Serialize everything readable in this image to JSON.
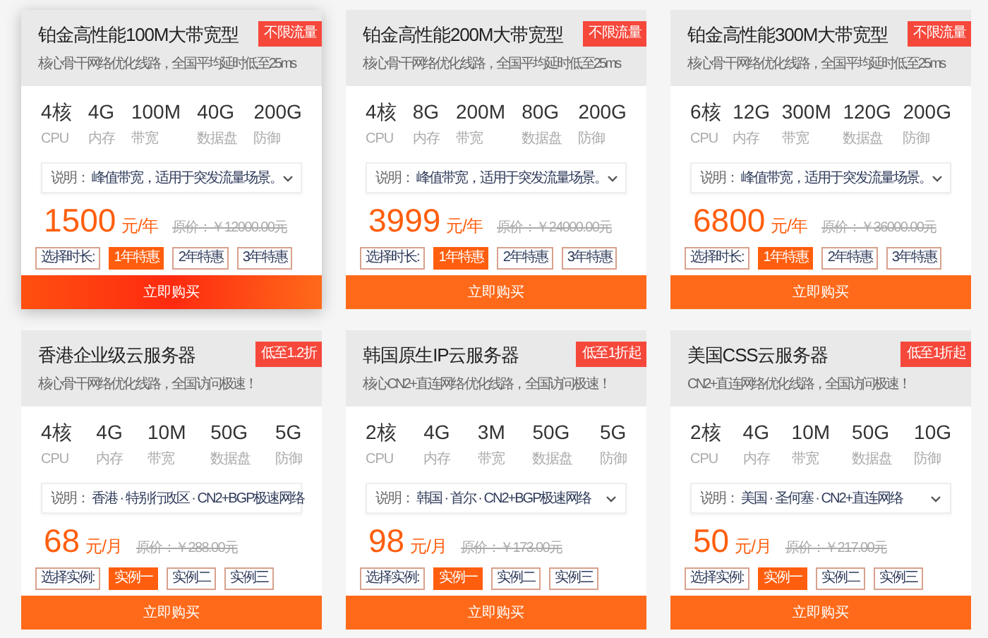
{
  "cards": [
    {
      "title": "铂金高性能100M大带宽型",
      "badge": "不限流量",
      "subtitle": "核心骨干网络优化线路，全国平均延时低至25ms",
      "hovered": true,
      "specs": [
        {
          "value": "4核",
          "label": "CPU"
        },
        {
          "value": "4G",
          "label": "内存"
        },
        {
          "value": "100M",
          "label": "带宽"
        },
        {
          "value": "40G",
          "label": "数据盘"
        },
        {
          "value": "200G",
          "label": "防御"
        }
      ],
      "note_label": "说明：",
      "note": "峰值带宽，适用于突发流量场景。",
      "has_dropdown": true,
      "price": "1500",
      "unit": "元/年",
      "original_price": "原价：￥12000.00元",
      "option_label": "选择时长:",
      "options": [
        {
          "label": "1年特惠",
          "selected": true
        },
        {
          "label": "2年特惠",
          "selected": false
        },
        {
          "label": "3年特惠",
          "selected": false
        }
      ],
      "buy": "立即购买"
    },
    {
      "title": "铂金高性能200M大带宽型",
      "badge": "不限流量",
      "subtitle": "核心骨干网络优化线路，全国平均延时低至25ms",
      "hovered": false,
      "specs": [
        {
          "value": "4核",
          "label": "CPU"
        },
        {
          "value": "8G",
          "label": "内存"
        },
        {
          "value": "200M",
          "label": "带宽"
        },
        {
          "value": "80G",
          "label": "数据盘"
        },
        {
          "value": "200G",
          "label": "防御"
        }
      ],
      "note_label": "说明：",
      "note": "峰值带宽，适用于突发流量场景。",
      "has_dropdown": true,
      "price": "3999",
      "unit": "元/年",
      "original_price": "原价：￥24000.00元",
      "option_label": "选择时长:",
      "options": [
        {
          "label": "1年特惠",
          "selected": true
        },
        {
          "label": "2年特惠",
          "selected": false
        },
        {
          "label": "3年特惠",
          "selected": false
        }
      ],
      "buy": "立即购买"
    },
    {
      "title": "铂金高性能300M大带宽型",
      "badge": "不限流量",
      "subtitle": "核心骨干网络优化线路，全国平均延时低至25ms",
      "hovered": false,
      "specs": [
        {
          "value": "6核",
          "label": "CPU"
        },
        {
          "value": "12G",
          "label": "内存"
        },
        {
          "value": "300M",
          "label": "带宽"
        },
        {
          "value": "120G",
          "label": "数据盘"
        },
        {
          "value": "200G",
          "label": "防御"
        }
      ],
      "note_label": "说明：",
      "note": "峰值带宽，适用于突发流量场景。",
      "has_dropdown": true,
      "price": "6800",
      "unit": "元/年",
      "original_price": "原价：￥36000.00元",
      "option_label": "选择时长:",
      "options": [
        {
          "label": "1年特惠",
          "selected": true
        },
        {
          "label": "2年特惠",
          "selected": false
        },
        {
          "label": "3年特惠",
          "selected": false
        }
      ],
      "buy": "立即购买"
    },
    {
      "title": "香港企业级云服务器",
      "badge": "低至1.2折",
      "subtitle": "核心骨干网络优化线路，全国访问极速！",
      "hovered": false,
      "specs": [
        {
          "value": "4核",
          "label": "CPU"
        },
        {
          "value": "4G",
          "label": "内存"
        },
        {
          "value": "10M",
          "label": "带宽"
        },
        {
          "value": "50G",
          "label": "数据盘"
        },
        {
          "value": "5G",
          "label": "防御"
        }
      ],
      "note_label": "说明：",
      "note": "香港 · 特别行政区 · CN2+BGP极速网络",
      "has_dropdown": false,
      "price": "68",
      "unit": "元/月",
      "original_price": "原价：￥288.00元",
      "option_label": "选择实例:",
      "options": [
        {
          "label": "实例一",
          "selected": true
        },
        {
          "label": "实例二",
          "selected": false
        },
        {
          "label": "实例三",
          "selected": false
        }
      ],
      "buy": "立即购买"
    },
    {
      "title": "韩国原生IP云服务器",
      "badge": "低至1折起",
      "subtitle": "核心CN2+直连网络优化线路，全国访问极速！",
      "hovered": false,
      "specs": [
        {
          "value": "2核",
          "label": "CPU"
        },
        {
          "value": "4G",
          "label": "内存"
        },
        {
          "value": "3M",
          "label": "带宽"
        },
        {
          "value": "50G",
          "label": "数据盘"
        },
        {
          "value": "5G",
          "label": "防御"
        }
      ],
      "note_label": "说明：",
      "note": "韩国 · 首尔 · CN2+BGP极速网络",
      "has_dropdown": true,
      "price": "98",
      "unit": "元/月",
      "original_price": "原价：￥173.00元",
      "option_label": "选择实例:",
      "options": [
        {
          "label": "实例一",
          "selected": true
        },
        {
          "label": "实例二",
          "selected": false
        },
        {
          "label": "实例三",
          "selected": false
        }
      ],
      "buy": "立即购买"
    },
    {
      "title": "美国CSS云服务器",
      "badge": "低至1折起",
      "subtitle": "CN2+直连网络优化线路，全国访问极速！",
      "hovered": false,
      "specs": [
        {
          "value": "2核",
          "label": "CPU"
        },
        {
          "value": "4G",
          "label": "内存"
        },
        {
          "value": "10M",
          "label": "带宽"
        },
        {
          "value": "50G",
          "label": "数据盘"
        },
        {
          "value": "10G",
          "label": "防御"
        }
      ],
      "note_label": "说明：",
      "note": "美国 · 圣何塞 · CN2+直连网络",
      "has_dropdown": true,
      "price": "50",
      "unit": "元/月",
      "original_price": "原价：￥217.00元",
      "option_label": "选择实例:",
      "options": [
        {
          "label": "实例一",
          "selected": true
        },
        {
          "label": "实例二",
          "selected": false
        },
        {
          "label": "实例三",
          "selected": false
        }
      ],
      "buy": "立即购买"
    }
  ]
}
